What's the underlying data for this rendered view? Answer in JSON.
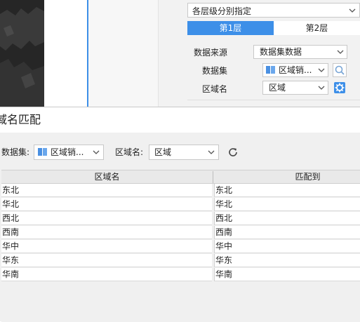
{
  "background_panel": {
    "layer_mode": "各层级分别指定",
    "tabs": [
      "第1层",
      "第2层"
    ],
    "data_source_label": "数据来源",
    "data_source_value": "数据集数据",
    "dataset_label": "数据集",
    "dataset_value": "区域销...",
    "region_field_label": "区域名",
    "region_field_value": "区域"
  },
  "dialog": {
    "title": "域名匹配",
    "dataset_label": "数据集:",
    "dataset_value": "区域销...",
    "region_label": "区域名:",
    "region_value": "区域",
    "columns": [
      "区域名",
      "匹配到"
    ],
    "rows": [
      [
        "东北",
        "东北"
      ],
      [
        "华北",
        "华北"
      ],
      [
        "西北",
        "西北"
      ],
      [
        "西南",
        "西南"
      ],
      [
        "华中",
        "华中"
      ],
      [
        "华东",
        "华东"
      ],
      [
        "华南",
        "华南"
      ]
    ]
  },
  "icons": {
    "dropdown": "chevron-down-icon",
    "dataset": "dataset-icon",
    "search": "search-icon",
    "settings": "gear-icon",
    "refresh": "refresh-icon"
  },
  "colors": {
    "accent": "#3d8fe8",
    "map_dark": "#2b2b2b"
  }
}
